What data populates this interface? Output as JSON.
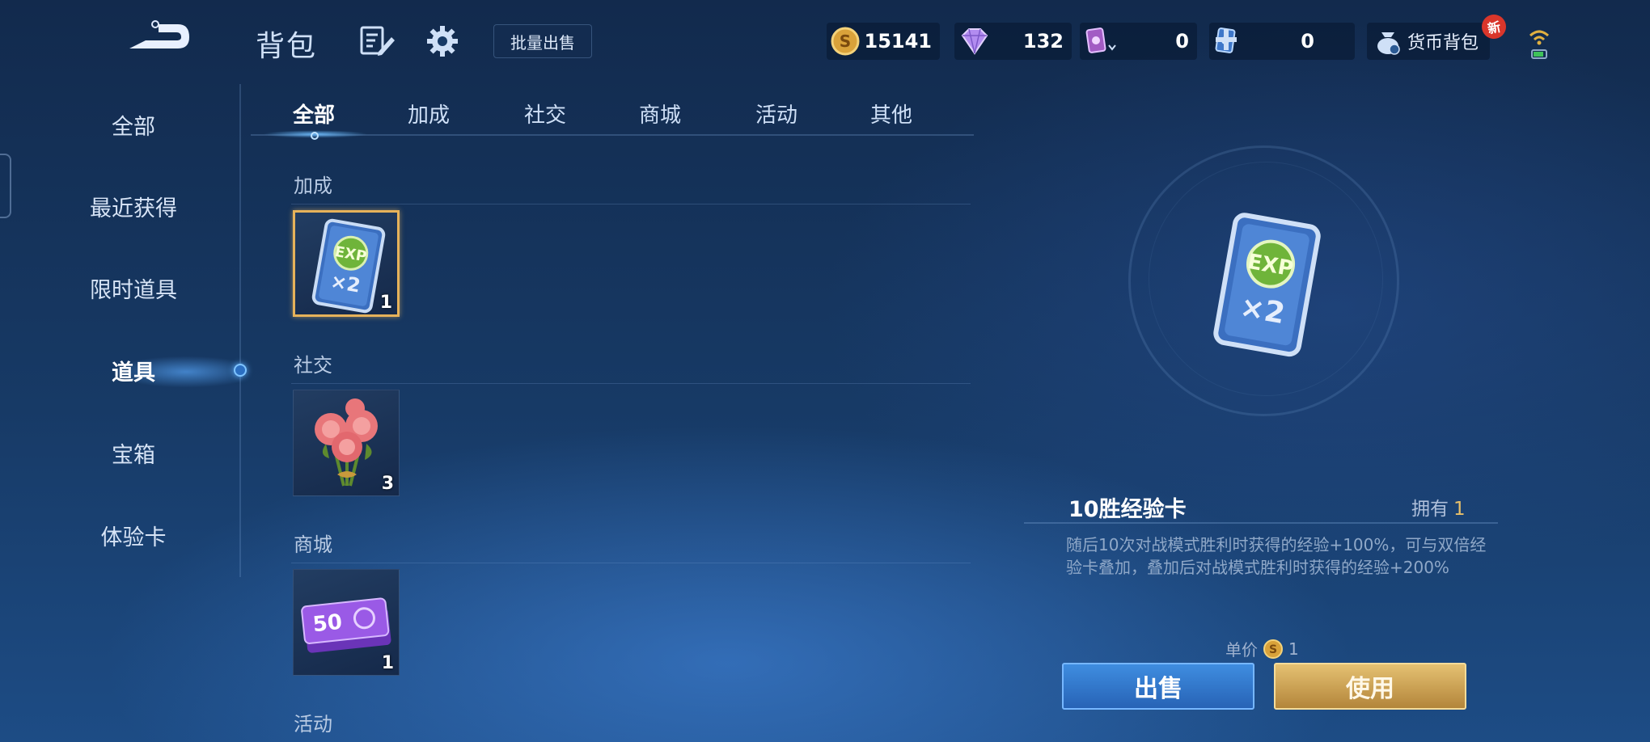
{
  "header": {
    "title": "背包",
    "batch_sell_label": "批量出售"
  },
  "currencies": {
    "coin": "15141",
    "gem": "132",
    "card1": "0",
    "card2": "0",
    "wallet_label": "货币背包",
    "new_badge": "新"
  },
  "sidebar": {
    "items": [
      {
        "label": "全部"
      },
      {
        "label": "最近获得"
      },
      {
        "label": "限时道具"
      },
      {
        "label": "道具"
      },
      {
        "label": "宝箱"
      },
      {
        "label": "体验卡"
      }
    ],
    "active_index": 3
  },
  "tabs": [
    {
      "label": "全部"
    },
    {
      "label": "加成"
    },
    {
      "label": "社交"
    },
    {
      "label": "商城"
    },
    {
      "label": "活动"
    },
    {
      "label": "其他"
    }
  ],
  "sections": [
    {
      "label": "加成",
      "item": {
        "name": "10胜经验卡",
        "count": "1",
        "icon": "exp-card-icon"
      }
    },
    {
      "label": "社交",
      "item": {
        "count": "3",
        "icon": "roses-icon"
      }
    },
    {
      "label": "商城",
      "item": {
        "count": "1",
        "icon": "coupon-icon",
        "value": "50"
      }
    },
    {
      "label": "活动"
    }
  ],
  "detail": {
    "name": "10胜经验卡",
    "owned_label": "拥有",
    "owned_count": "1",
    "description": "随后10次对战模式胜利时获得的经验+100%，可与双倍经验卡叠加，叠加后对战模式胜利时获得的经验+200%",
    "price_label": "单价",
    "price": "1",
    "sell_label": "出售",
    "use_label": "使用"
  },
  "colors": {
    "accent_gold": "#e6b25a",
    "button_blue": "#3f8de0",
    "button_gold": "#e5c172"
  }
}
